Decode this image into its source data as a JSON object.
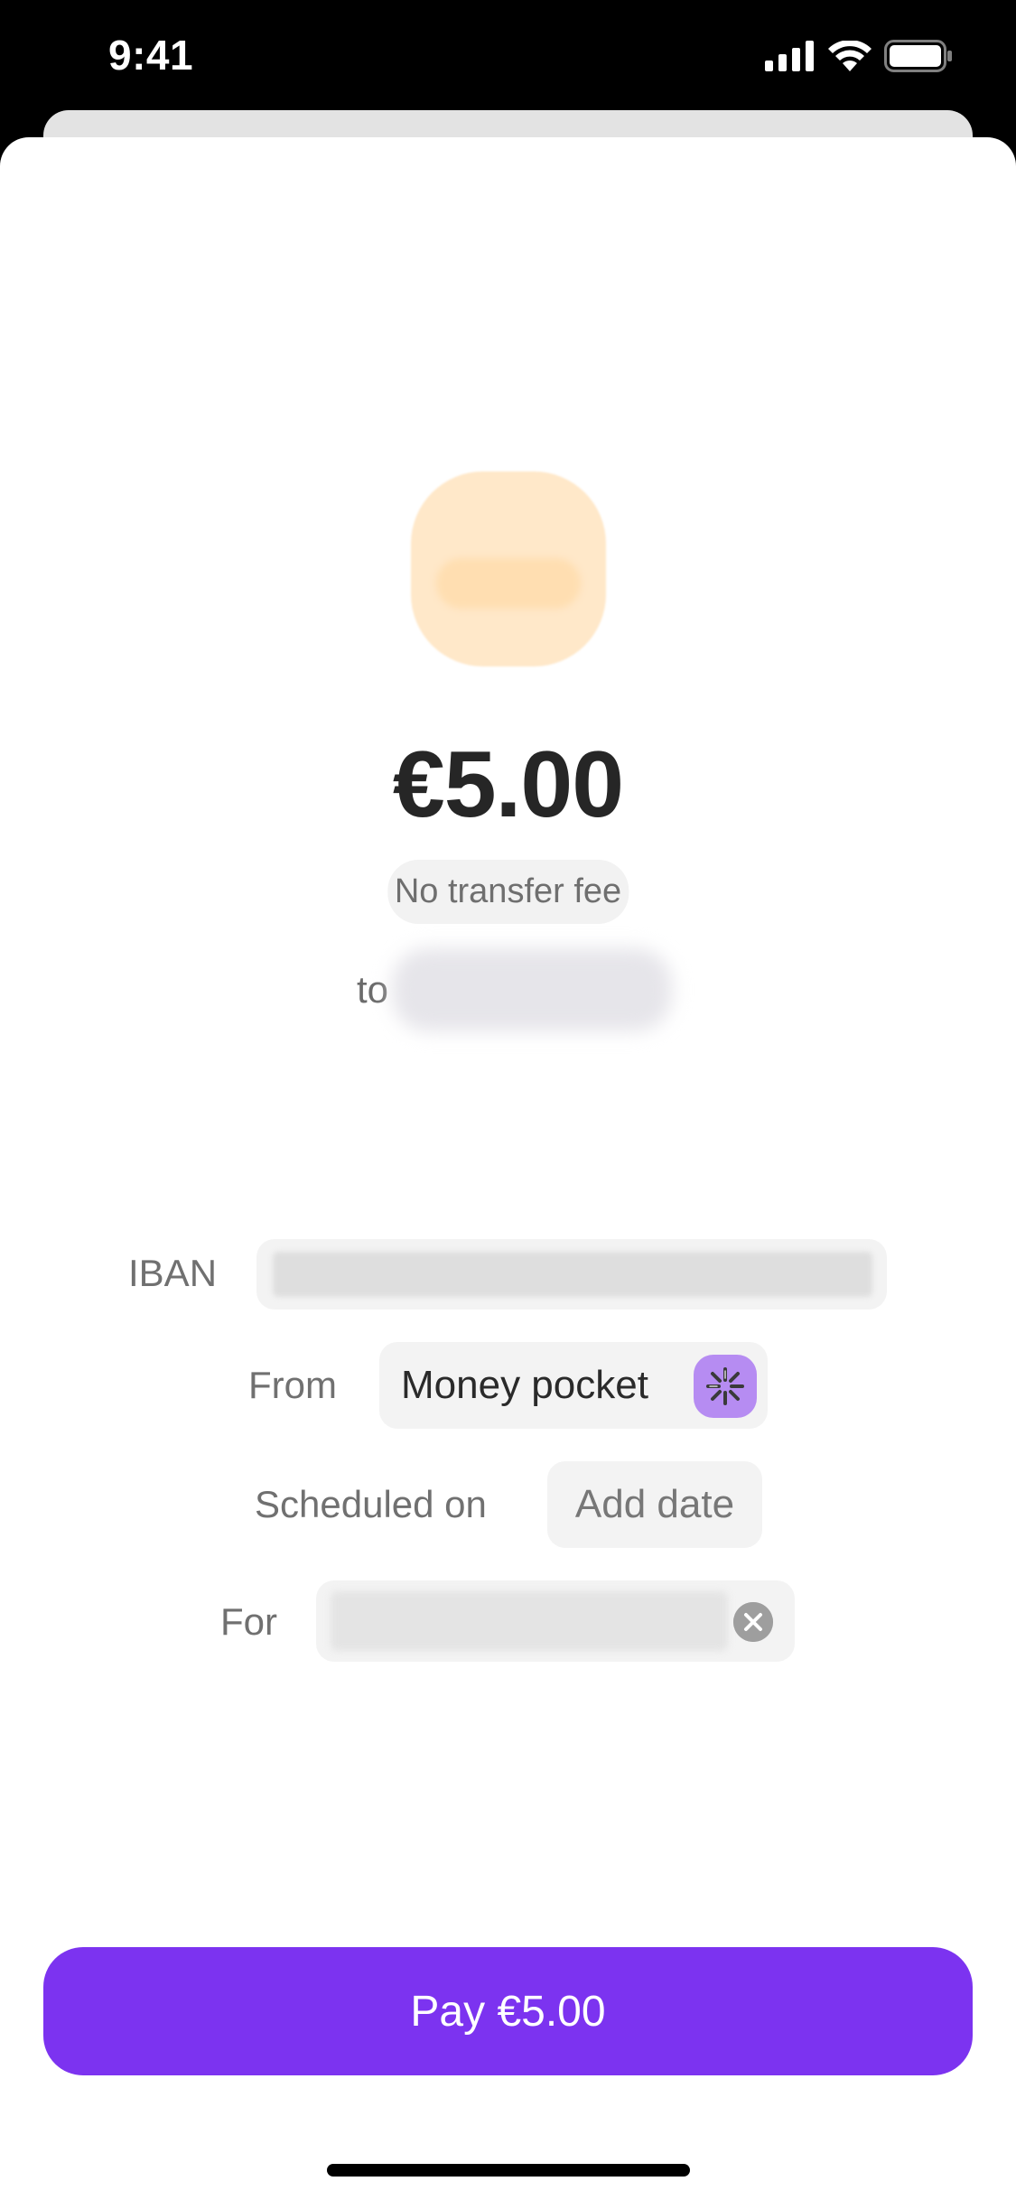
{
  "status_bar": {
    "time": "9:41",
    "icons": [
      "signal-icon",
      "wifi-icon",
      "battery-icon"
    ]
  },
  "payment": {
    "amount": "€5.00",
    "fee_note": "No transfer fee",
    "to_label": "to"
  },
  "details": {
    "iban_label": "IBAN",
    "from_label": "From",
    "from_value": "Money pocket",
    "scheduled_label": "Scheduled on",
    "scheduled_value": "Add date",
    "for_label": "For"
  },
  "actions": {
    "pay_label": "Pay €5.00"
  },
  "colors": {
    "accent": "#7c33f0",
    "pocket_icon_bg": "#b68cf2",
    "logo_bg": "#ffe8c9"
  }
}
